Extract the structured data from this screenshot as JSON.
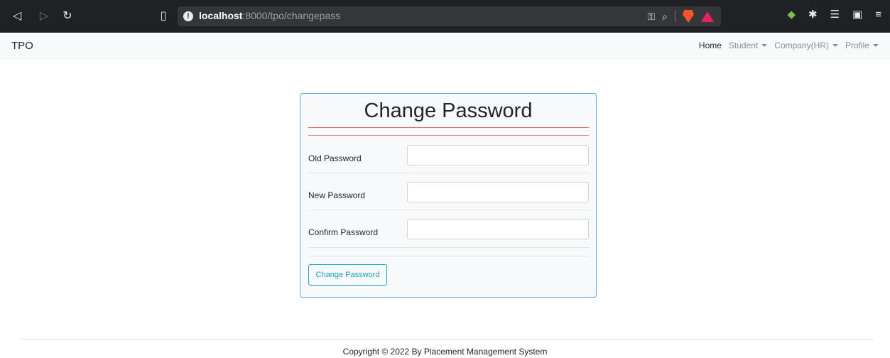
{
  "browser": {
    "url_host": "localhost",
    "url_path": ":8000/tpo/changepass",
    "icons": [
      "back-icon",
      "forward-icon",
      "reload-icon",
      "bookmark-icon",
      "info-icon",
      "key-icon",
      "zoom-icon",
      "brave-shield-icon",
      "brave-rewards-icon",
      "extension-icon",
      "puzzle-icon",
      "playlist-icon",
      "wallet-icon",
      "menu-icon"
    ]
  },
  "navbar": {
    "brand": "TPO",
    "links": {
      "home": "Home",
      "student": "Student",
      "company": "Company(HR)",
      "profile": "Profile"
    }
  },
  "form": {
    "title": "Change Password",
    "fields": {
      "old": {
        "label": "Old Password",
        "value": ""
      },
      "new": {
        "label": "New Password",
        "value": ""
      },
      "confirm": {
        "label": "Confirm Password",
        "value": ""
      }
    },
    "submit_label": "Change Password"
  },
  "footer": {
    "text": "Copyright © 2022 By Placement Management System"
  },
  "colors": {
    "card_border": "#5ea8ee",
    "title_rule": "#e57373",
    "button": "#17a2b8"
  }
}
